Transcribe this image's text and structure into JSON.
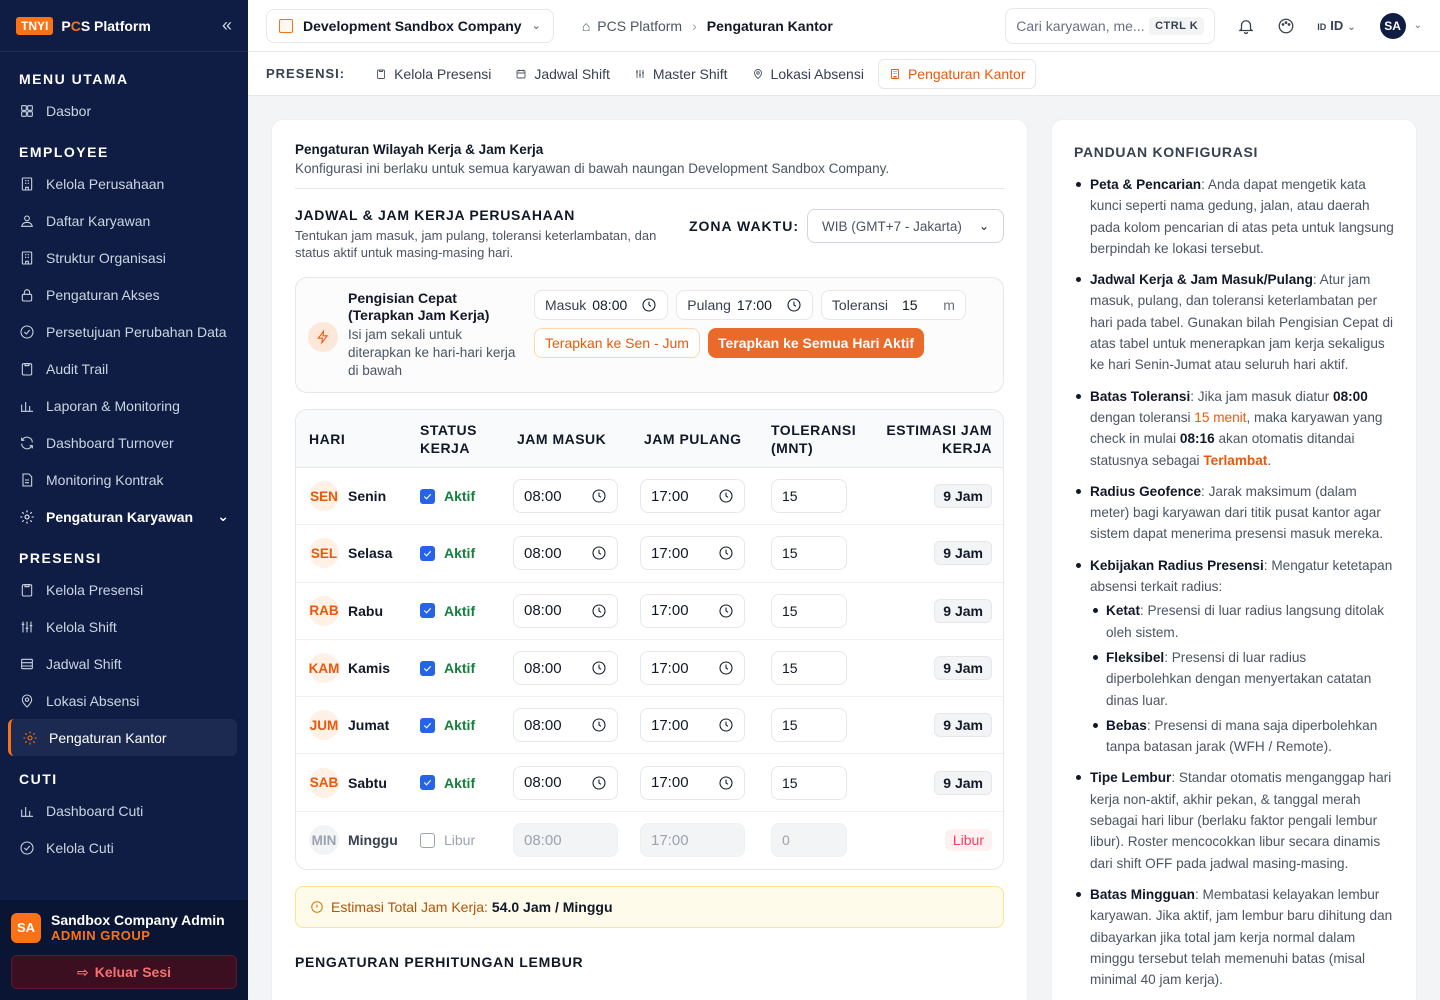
{
  "sidebar": {
    "logo_tag": "TNYI",
    "logo_a": "P",
    "logo_o": "C",
    "logo_b": "S Platform",
    "sections": [
      {
        "title": "MENU UTAMA",
        "items": [
          {
            "label": "Dasbor",
            "icon": "grid-icon"
          }
        ]
      },
      {
        "title": "EMPLOYEE",
        "items": [
          {
            "label": "Kelola Perusahaan",
            "icon": "building-icon"
          },
          {
            "label": "Daftar Karyawan",
            "icon": "users-icon"
          },
          {
            "label": "Struktur Organisasi",
            "icon": "building-icon"
          },
          {
            "label": "Pengaturan Akses",
            "icon": "lock-icon"
          },
          {
            "label": "Persetujuan Perubahan Data",
            "icon": "check-circle-icon"
          },
          {
            "label": "Audit Trail",
            "icon": "clipboard-icon"
          },
          {
            "label": "Laporan & Monitoring",
            "icon": "chart-icon"
          },
          {
            "label": "Dashboard Turnover",
            "icon": "refresh-icon"
          },
          {
            "label": "Monitoring Kontrak",
            "icon": "document-icon"
          },
          {
            "label": "Pengaturan Karyawan",
            "icon": "gear-icon"
          }
        ]
      },
      {
        "title": "PRESENSI",
        "items": [
          {
            "label": "Kelola Presensi",
            "icon": "clipboard-icon"
          },
          {
            "label": "Kelola Shift",
            "icon": "sliders-icon"
          },
          {
            "label": "Jadwal Shift",
            "icon": "table-icon"
          },
          {
            "label": "Lokasi Absensi",
            "icon": "pin-icon"
          },
          {
            "label": "Pengaturan Kantor",
            "icon": "gear-icon"
          }
        ]
      },
      {
        "title": "CUTI",
        "items": [
          {
            "label": "Dashboard Cuti",
            "icon": "chart-icon"
          },
          {
            "label": "Kelola Cuti",
            "icon": "check-circle-icon"
          }
        ]
      }
    ],
    "user": {
      "initials": "SA",
      "name": "Sandbox Company Admin",
      "group": "ADMIN GROUP"
    },
    "logout_label": "Keluar Sesi"
  },
  "header": {
    "company": "Development Sandbox Company",
    "breadcrumb": [
      "PCS Platform",
      "Pengaturan Kantor"
    ],
    "search_placeholder": "Cari karyawan, me...",
    "search_kbd": "CTRL K",
    "lang": "ID",
    "lang_prefix": "ID",
    "avatar": "SA"
  },
  "tabs": {
    "label": "PRESENSI:",
    "items": [
      "Kelola Presensi",
      "Jadwal Shift",
      "Master Shift",
      "Lokasi Absensi",
      "Pengaturan Kantor"
    ]
  },
  "main": {
    "title": "Pengaturan Wilayah Kerja & Jam Kerja",
    "subtitle": "Konfigurasi ini berlaku untuk semua karyawan di bawah naungan Development Sandbox Company.",
    "schedule_title": "JADWAL & JAM KERJA PERUSAHAAN",
    "schedule_sub": "Tentukan jam masuk, jam pulang, toleransi keterlambatan, dan status aktif untuk masing-masing hari.",
    "tz_label": "ZONA WAKTU:",
    "tz_value": "WIB (GMT+7 - Jakarta)",
    "quick": {
      "title": "Pengisian Cepat (Terapkan Jam Kerja)",
      "desc": "Isi jam sekali untuk diterapkan ke hari-hari kerja di bawah",
      "masuk_label": "Masuk",
      "masuk": "08:00",
      "pulang_label": "Pulang",
      "pulang": "17:00",
      "tol_label": "Toleransi",
      "tol": "15",
      "tol_unit": "m",
      "btn_weekday": "Terapkan ke Sen - Jum",
      "btn_all": "Terapkan ke Semua Hari Aktif"
    },
    "table": {
      "headers": {
        "day": "HARI",
        "status": "STATUS KERJA",
        "in": "JAM MASUK",
        "out": "JAM PULANG",
        "tol": "TOLERANSI (MNT)",
        "est": "ESTIMASI JAM KERJA"
      },
      "rows": [
        {
          "abbr": "SEN",
          "name": "Senin",
          "status": "Aktif",
          "in": "08:00",
          "out": "17:00",
          "tol": "15",
          "est": "9 Jam"
        },
        {
          "abbr": "SEL",
          "name": "Selasa",
          "status": "Aktif",
          "in": "08:00",
          "out": "17:00",
          "tol": "15",
          "est": "9 Jam"
        },
        {
          "abbr": "RAB",
          "name": "Rabu",
          "status": "Aktif",
          "in": "08:00",
          "out": "17:00",
          "tol": "15",
          "est": "9 Jam"
        },
        {
          "abbr": "KAM",
          "name": "Kamis",
          "status": "Aktif",
          "in": "08:00",
          "out": "17:00",
          "tol": "15",
          "est": "9 Jam"
        },
        {
          "abbr": "JUM",
          "name": "Jumat",
          "status": "Aktif",
          "in": "08:00",
          "out": "17:00",
          "tol": "15",
          "est": "9 Jam"
        },
        {
          "abbr": "SAB",
          "name": "Sabtu",
          "status": "Aktif",
          "in": "08:00",
          "out": "17:00",
          "tol": "15",
          "est": "9 Jam"
        },
        {
          "abbr": "MIN",
          "name": "Minggu",
          "status": "Libur",
          "in": "08:00",
          "out": "17:00",
          "tol": "0",
          "est": "Libur"
        }
      ]
    },
    "total_label": "Estimasi Total Jam Kerja:",
    "total_value": "54.0 Jam / Minggu",
    "overtime_title": "PENGATURAN PERHITUNGAN LEMBUR"
  },
  "guide": {
    "title": "PANDUAN KONFIGURASI",
    "peta_b": "Peta & Pencarian",
    "peta": ": Anda dapat mengetik kata kunci seperti nama gedung, jalan, atau daerah pada kolom pencarian di atas peta untuk langsung berpindah ke lokasi tersebut.",
    "jadwal_b": "Jadwal Kerja & Jam Masuk/Pulang",
    "jadwal": ": Atur jam masuk, pulang, dan toleransi keterlambatan per hari pada tabel. Gunakan bilah Pengisian Cepat di atas tabel untuk menerapkan jam kerja sekaligus ke hari Senin-Jumat atau seluruh hari aktif.",
    "batas_b": "Batas Toleransi",
    "batas_1": ": Jika jam masuk diatur ",
    "batas_t1": "08:00",
    "batas_2": " dengan toleransi ",
    "batas_t2": "15 menit",
    "batas_3": ", maka karyawan yang check in mulai ",
    "batas_t3": "08:16",
    "batas_4": " akan otomatis ditandai statusnya sebagai ",
    "batas_t4": "Terlambat",
    "batas_5": ".",
    "radius_b": "Radius Geofence",
    "radius": ": Jarak maksimum (dalam meter) bagi karyawan dari titik pusat kantor agar sistem dapat menerima presensi masuk mereka.",
    "kebijakan_b": "Kebijakan Radius Presensi",
    "kebijakan": ": Mengatur ketetapan absensi terkait radius:",
    "sub": [
      {
        "b": "Ketat",
        "t": ": Presensi di luar radius langsung ditolak oleh sistem."
      },
      {
        "b": "Fleksibel",
        "t": ": Presensi di luar radius diperbolehkan dengan menyertakan catatan dinas luar."
      },
      {
        "b": "Bebas",
        "t": ": Presensi di mana saja diperbolehkan tanpa batasan jarak (WFH / Remote)."
      }
    ],
    "lembur_b": "Tipe Lembur",
    "lembur": ": Standar otomatis menganggap hari kerja non-aktif, akhir pekan, & tanggal merah sebagai hari libur (berlaku faktor pengali lembur libur). Roster mencocokkan libur secara dinamis dari shift OFF pada jadwal masing-masing.",
    "mingguan_b": "Batas Mingguan",
    "mingguan": ": Membatasi kelayakan lembur karyawan. Jika aktif, jam lembur baru dihitung dan dibayarkan jika total jam kerja normal dalam minggu tersebut telah memenuhi batas (misal minimal 40 jam kerja)."
  }
}
